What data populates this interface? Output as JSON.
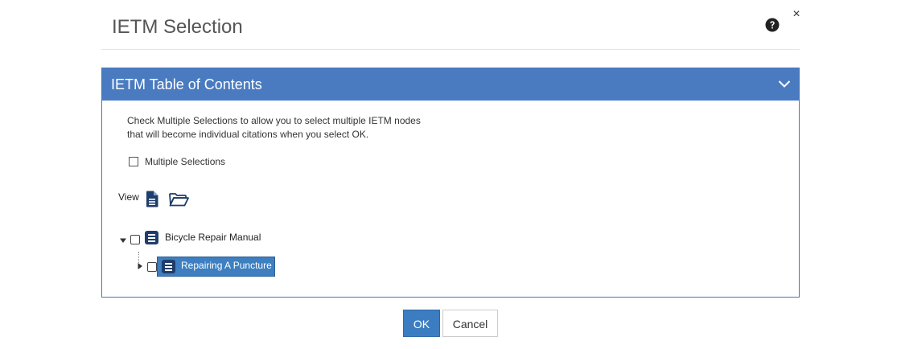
{
  "dialog": {
    "title": "IETM Selection",
    "help_icon": "question-circle-icon",
    "close_label": "×"
  },
  "panel": {
    "title": "IETM Table of Contents",
    "collapse_icon": "chevron-down-icon",
    "description_line1": "Check Multiple Selections to allow you to select multiple IETM nodes",
    "description_line2": "that will become individual citations when you select OK.",
    "multiple_selections": {
      "label": "Multiple Selections",
      "checked": false
    },
    "view": {
      "label": "View",
      "icons": [
        "document-icon",
        "folder-open-icon"
      ]
    },
    "tree": {
      "nodes": [
        {
          "label": "Bicycle Repair Manual",
          "expanded": true,
          "checked": false,
          "icon": "list-icon",
          "children": [
            {
              "label": "Repairing A Puncture",
              "expanded": false,
              "checked": false,
              "selected": true,
              "icon": "list-icon"
            }
          ]
        }
      ]
    }
  },
  "footer": {
    "ok_label": "OK",
    "cancel_label": "Cancel"
  },
  "colors": {
    "header_bg": "#4a7bc0",
    "selected_bg": "#3d7fc1",
    "ok_bg": "#3c7dc2",
    "icon_navy": "#1f3d6b"
  }
}
